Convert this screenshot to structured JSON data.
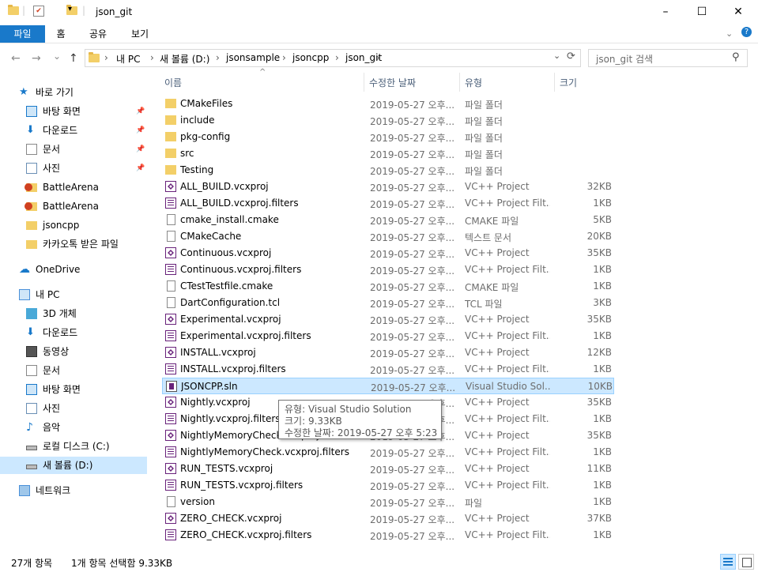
{
  "window": {
    "title": "json_git",
    "minimize": "–",
    "maximize": "☐",
    "close": "✕"
  },
  "ribbon": {
    "tabs": [
      "파일",
      "홈",
      "공유",
      "보기"
    ]
  },
  "nav": {
    "back": "←",
    "forward": "→",
    "recent": "⌄",
    "up": "↑",
    "refresh": "⟳"
  },
  "address": {
    "segments": [
      "내 PC",
      "새 볼륨 (D:)",
      "jsonsample",
      "jsoncpp",
      "json_git"
    ],
    "sep": "›"
  },
  "search": {
    "placeholder": "json_git 검색"
  },
  "sidebar": {
    "items": [
      {
        "label": "바로 가기",
        "icon": "star-icon",
        "level": 0
      },
      {
        "label": "바탕 화면",
        "icon": "desktop-icon",
        "level": 1,
        "pinned": true
      },
      {
        "label": "다운로드",
        "icon": "download-icon",
        "level": 1,
        "pinned": true
      },
      {
        "label": "문서",
        "icon": "document-icon",
        "level": 1,
        "pinned": true
      },
      {
        "label": "사진",
        "icon": "picture-icon",
        "level": 1,
        "pinned": true
      },
      {
        "label": "BattleArena",
        "icon": "warning-folder-icon",
        "level": 1
      },
      {
        "label": "BattleArena",
        "icon": "warning-folder-icon",
        "level": 1
      },
      {
        "label": "jsoncpp",
        "icon": "folder-icon",
        "level": 1
      },
      {
        "label": "카카오톡 받은 파일",
        "icon": "folder-icon",
        "level": 1
      },
      {
        "label": "OneDrive",
        "icon": "cloud-icon",
        "level": 0
      },
      {
        "label": "내 PC",
        "icon": "pc-icon",
        "level": 0
      },
      {
        "label": "3D 개체",
        "icon": "cube-icon",
        "level": 1
      },
      {
        "label": "다운로드",
        "icon": "download-icon",
        "level": 1
      },
      {
        "label": "동영상",
        "icon": "film-icon",
        "level": 1
      },
      {
        "label": "문서",
        "icon": "document-icon",
        "level": 1
      },
      {
        "label": "바탕 화면",
        "icon": "desktop-icon",
        "level": 1
      },
      {
        "label": "사진",
        "icon": "picture-icon",
        "level": 1
      },
      {
        "label": "음악",
        "icon": "music-icon",
        "level": 1
      },
      {
        "label": "로컬 디스크 (C:)",
        "icon": "drive-icon",
        "level": 1
      },
      {
        "label": "새 볼륨 (D:)",
        "icon": "drive-icon",
        "level": 1,
        "selected": true
      },
      {
        "label": "네트워크",
        "icon": "network-icon",
        "level": 0
      }
    ]
  },
  "columns": {
    "name": "이름",
    "date": "수정한 날짜",
    "type": "유형",
    "size": "크기"
  },
  "files": [
    {
      "name": "CMakeFiles",
      "date": "2019-05-27 오후...",
      "type": "파일 폴더",
      "size": "",
      "kind": "folder"
    },
    {
      "name": "include",
      "date": "2019-05-27 오후...",
      "type": "파일 폴더",
      "size": "",
      "kind": "folder"
    },
    {
      "name": "pkg-config",
      "date": "2019-05-27 오후...",
      "type": "파일 폴더",
      "size": "",
      "kind": "folder"
    },
    {
      "name": "src",
      "date": "2019-05-27 오후...",
      "type": "파일 폴더",
      "size": "",
      "kind": "folder"
    },
    {
      "name": "Testing",
      "date": "2019-05-27 오후...",
      "type": "파일 폴더",
      "size": "",
      "kind": "folder"
    },
    {
      "name": "ALL_BUILD.vcxproj",
      "date": "2019-05-27 오후...",
      "type": "VC++ Project",
      "size": "32KB",
      "kind": "vcx"
    },
    {
      "name": "ALL_BUILD.vcxproj.filters",
      "date": "2019-05-27 오후...",
      "type": "VC++ Project Filt...",
      "size": "1KB",
      "kind": "filt"
    },
    {
      "name": "cmake_install.cmake",
      "date": "2019-05-27 오후...",
      "type": "CMAKE 파일",
      "size": "5KB",
      "kind": "doc"
    },
    {
      "name": "CMakeCache",
      "date": "2019-05-27 오후...",
      "type": "텍스트 문서",
      "size": "20KB",
      "kind": "doc"
    },
    {
      "name": "Continuous.vcxproj",
      "date": "2019-05-27 오후...",
      "type": "VC++ Project",
      "size": "35KB",
      "kind": "vcx"
    },
    {
      "name": "Continuous.vcxproj.filters",
      "date": "2019-05-27 오후...",
      "type": "VC++ Project Filt...",
      "size": "1KB",
      "kind": "filt"
    },
    {
      "name": "CTestTestfile.cmake",
      "date": "2019-05-27 오후...",
      "type": "CMAKE 파일",
      "size": "1KB",
      "kind": "doc"
    },
    {
      "name": "DartConfiguration.tcl",
      "date": "2019-05-27 오후...",
      "type": "TCL 파일",
      "size": "3KB",
      "kind": "doc"
    },
    {
      "name": "Experimental.vcxproj",
      "date": "2019-05-27 오후...",
      "type": "VC++ Project",
      "size": "35KB",
      "kind": "vcx"
    },
    {
      "name": "Experimental.vcxproj.filters",
      "date": "2019-05-27 오후...",
      "type": "VC++ Project Filt...",
      "size": "1KB",
      "kind": "filt"
    },
    {
      "name": "INSTALL.vcxproj",
      "date": "2019-05-27 오후...",
      "type": "VC++ Project",
      "size": "12KB",
      "kind": "vcx"
    },
    {
      "name": "INSTALL.vcxproj.filters",
      "date": "2019-05-27 오후...",
      "type": "VC++ Project Filt...",
      "size": "1KB",
      "kind": "filt"
    },
    {
      "name": "JSONCPP.sln",
      "date": "2019-05-27 오후...",
      "type": "Visual Studio Sol...",
      "size": "10KB",
      "kind": "sln",
      "selected": true
    },
    {
      "name": "Nightly.vcxproj",
      "date": "2019-05-27 오후...",
      "type": "VC++ Project",
      "size": "35KB",
      "kind": "vcx"
    },
    {
      "name": "Nightly.vcxproj.filters",
      "date": "2019-05-27 오후...",
      "type": "VC++ Project Filt...",
      "size": "1KB",
      "kind": "filt"
    },
    {
      "name": "NightlyMemoryCheck.vcxproj",
      "date": "2019-05-27 오후...",
      "type": "VC++ Project",
      "size": "35KB",
      "kind": "vcx"
    },
    {
      "name": "NightlyMemoryCheck.vcxproj.filters",
      "date": "2019-05-27 오후...",
      "type": "VC++ Project Filt...",
      "size": "1KB",
      "kind": "filt"
    },
    {
      "name": "RUN_TESTS.vcxproj",
      "date": "2019-05-27 오후...",
      "type": "VC++ Project",
      "size": "11KB",
      "kind": "vcx"
    },
    {
      "name": "RUN_TESTS.vcxproj.filters",
      "date": "2019-05-27 오후...",
      "type": "VC++ Project Filt...",
      "size": "1KB",
      "kind": "filt"
    },
    {
      "name": "version",
      "date": "2019-05-27 오후...",
      "type": "파일",
      "size": "1KB",
      "kind": "doc"
    },
    {
      "name": "ZERO_CHECK.vcxproj",
      "date": "2019-05-27 오후...",
      "type": "VC++ Project",
      "size": "37KB",
      "kind": "vcx"
    },
    {
      "name": "ZERO_CHECK.vcxproj.filters",
      "date": "2019-05-27 오후...",
      "type": "VC++ Project Filt...",
      "size": "1KB",
      "kind": "filt"
    }
  ],
  "tooltip": {
    "type_line": "유형: Visual Studio Solution",
    "size_line": "크기: 9.33KB",
    "date_line": "수정한 날짜: 2019-05-27 오후 5:23"
  },
  "status": {
    "count": "27개 항목",
    "selection": "1개 항목 선택함 9.33KB"
  },
  "colors": {
    "accent": "#1979ca",
    "selection": "#cce8ff",
    "folder": "#f3cf68",
    "vs_purple": "#68217a"
  }
}
